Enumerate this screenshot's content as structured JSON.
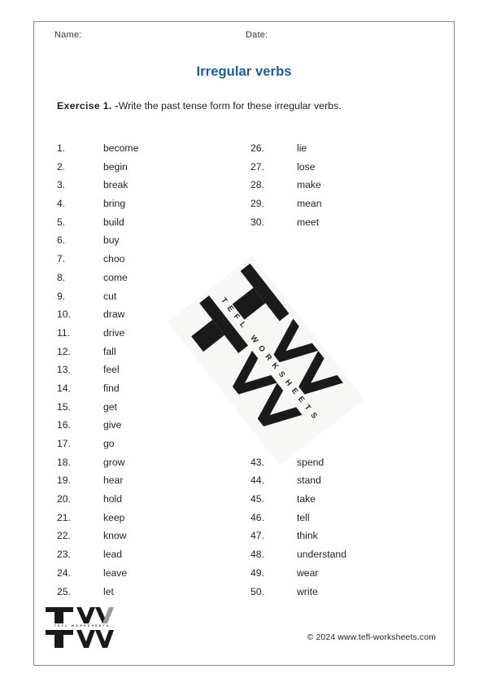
{
  "header": {
    "name_label": "Name:",
    "date_label": "Date:"
  },
  "title": "Irregular verbs",
  "exercise": {
    "label": "Exercise 1. -",
    "instruction": "Write the past tense form for these irregular verbs."
  },
  "colors": {
    "title_blue": "#1F5C99",
    "text": "#231F20",
    "border": "#8C8C8C",
    "watermark_bg": "#F7F7F5",
    "logo_black": "#1A1A1A"
  },
  "verbs": {
    "left_column": [
      {
        "num": "1.",
        "word": "become"
      },
      {
        "num": "2.",
        "word": "begin"
      },
      {
        "num": "3.",
        "word": "break"
      },
      {
        "num": "4.",
        "word": "bring"
      },
      {
        "num": "5.",
        "word": "build"
      },
      {
        "num": "6.",
        "word": "buy"
      },
      {
        "num": "7.",
        "word": "choo"
      },
      {
        "num": "8.",
        "word": "come"
      },
      {
        "num": "9.",
        "word": "cut"
      },
      {
        "num": "10.",
        "word": "draw"
      },
      {
        "num": "11.",
        "word": "drive"
      },
      {
        "num": "12.",
        "word": "fall"
      },
      {
        "num": "13.",
        "word": "feel"
      },
      {
        "num": "14.",
        "word": "find"
      },
      {
        "num": "15.",
        "word": "get"
      },
      {
        "num": "16.",
        "word": "give"
      },
      {
        "num": "17.",
        "word": "go"
      },
      {
        "num": "18.",
        "word": "grow"
      },
      {
        "num": "19.",
        "word": "hear"
      },
      {
        "num": "20.",
        "word": "hold"
      },
      {
        "num": "21.",
        "word": "keep"
      },
      {
        "num": "22.",
        "word": "know"
      },
      {
        "num": "23.",
        "word": "lead"
      },
      {
        "num": "24.",
        "word": "leave"
      },
      {
        "num": "25.",
        "word": "let"
      }
    ],
    "right_column": [
      {
        "num": "26.",
        "word": "lie"
      },
      {
        "num": "27.",
        "word": "lose"
      },
      {
        "num": "28.",
        "word": "make"
      },
      {
        "num": "29.",
        "word": "mean"
      },
      {
        "num": "30.",
        "word": "meet"
      },
      {
        "num": "",
        "word": ""
      },
      {
        "num": "",
        "word": ""
      },
      {
        "num": "",
        "word": ""
      },
      {
        "num": "",
        "word": ""
      },
      {
        "num": "",
        "word": ""
      },
      {
        "num": "",
        "word": ""
      },
      {
        "num": "",
        "word": ""
      },
      {
        "num": "",
        "word": ""
      },
      {
        "num": "",
        "word": ""
      },
      {
        "num": "",
        "word": ""
      },
      {
        "num": "",
        "word": ""
      },
      {
        "num": "",
        "word": ""
      },
      {
        "num": "43.",
        "word": "spend"
      },
      {
        "num": "44.",
        "word": "stand"
      },
      {
        "num": "45.",
        "word": "take"
      },
      {
        "num": "46.",
        "word": "tell"
      },
      {
        "num": "47.",
        "word": "think"
      },
      {
        "num": "48.",
        "word": "understand"
      },
      {
        "num": "49.",
        "word": "wear"
      },
      {
        "num": "50.",
        "word": "write"
      }
    ]
  },
  "watermark": {
    "text": "TEFL WORKSHEETS",
    "logo_letters": "TW"
  },
  "footer": {
    "logo_letters": "TW",
    "logo_subtext": "TEFL WORKSHEETS",
    "copyright": "© 2024 www.tefl-worksheets.com"
  }
}
